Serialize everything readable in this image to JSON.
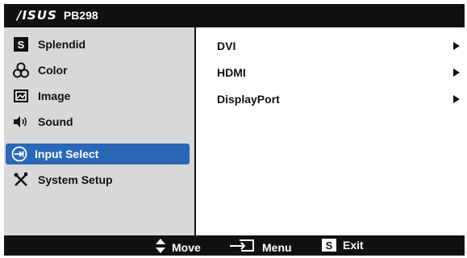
{
  "title": {
    "brand": "/ISUS",
    "model": "PB298"
  },
  "sidebar": {
    "items": [
      {
        "label": "Splendid",
        "icon": "splendid-s-icon"
      },
      {
        "label": "Color",
        "icon": "color-circles-icon"
      },
      {
        "label": "Image",
        "icon": "image-icon"
      },
      {
        "label": "Sound",
        "icon": "speaker-icon"
      },
      {
        "label": "Input Select",
        "icon": "input-select-icon",
        "selected": true
      },
      {
        "label": "System Setup",
        "icon": "tools-icon"
      }
    ]
  },
  "content": {
    "options": [
      {
        "label": "DVI",
        "icon": "right-triangle-icon"
      },
      {
        "label": "HDMI",
        "icon": "right-triangle-icon"
      },
      {
        "label": "DisplayPort",
        "icon": "right-triangle-icon"
      }
    ]
  },
  "footer": {
    "move": {
      "label": "Move",
      "icon": "up-down-arrows-icon"
    },
    "menu": {
      "label": "Menu",
      "icon": "enter-icon"
    },
    "exit": {
      "label": "Exit",
      "icon": "s-key-icon",
      "key": "S"
    }
  },
  "colors": {
    "selected": "#2a67b6",
    "bar": "#111111",
    "sidebar": "#d8d8d8"
  }
}
